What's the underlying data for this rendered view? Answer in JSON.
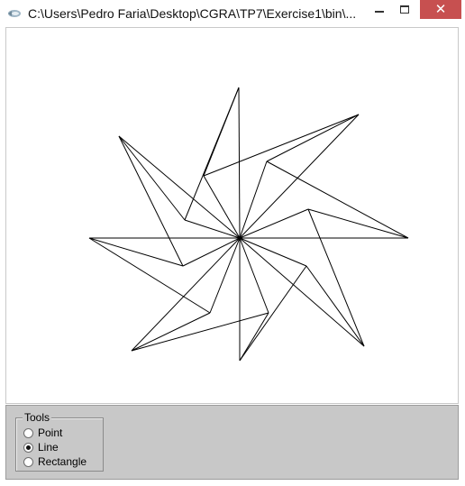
{
  "window": {
    "title": "C:\\Users\\Pedro Faria\\Desktop\\CGRA\\TP7\\Exercise1\\bin\\...",
    "close_symbol": "✕"
  },
  "canvas": {
    "figure": "eight-point star drawn with lines"
  },
  "tools": {
    "group_label": "Tools",
    "options": [
      {
        "label": "Point",
        "selected": false
      },
      {
        "label": "Line",
        "selected": true
      },
      {
        "label": "Rectangle",
        "selected": false
      }
    ]
  },
  "colors": {
    "close_button": "#c75050",
    "panel": "#c8c8c8",
    "stroke": "#000000"
  }
}
